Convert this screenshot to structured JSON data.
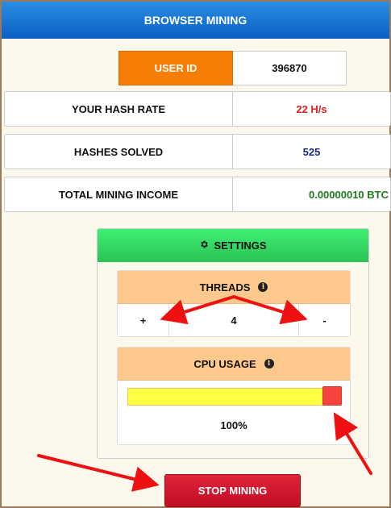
{
  "header": {
    "title": "BROWSER MINING"
  },
  "user": {
    "label": "USER ID",
    "value": "396870"
  },
  "stats": {
    "hash_rate": {
      "label": "YOUR HASH RATE",
      "value": "22 H/s",
      "color": "#e31e1e"
    },
    "hashes_solved": {
      "label": "HASHES SOLVED",
      "value": "525",
      "color": "#1c2a8a"
    },
    "total_income": {
      "label": "TOTAL MINING INCOME",
      "value": "0.00000010 BTC",
      "color": "#1f7a1f"
    }
  },
  "settings": {
    "title": "SETTINGS",
    "threads": {
      "label": "THREADS",
      "plus": "+",
      "value": "4",
      "minus": "-"
    },
    "cpu": {
      "label": "CPU USAGE",
      "value": "100%",
      "level": 1.0
    }
  },
  "actions": {
    "stop_label": "STOP MINING"
  },
  "colors": {
    "accent_orange": "#f77d04",
    "header_blue": "#0a5fc3",
    "settings_green": "#2ac255",
    "stop_red": "#c10d25",
    "annotation_red": "#ee1111"
  },
  "icons": {
    "settings": "gear-icon",
    "info": "info-icon"
  }
}
